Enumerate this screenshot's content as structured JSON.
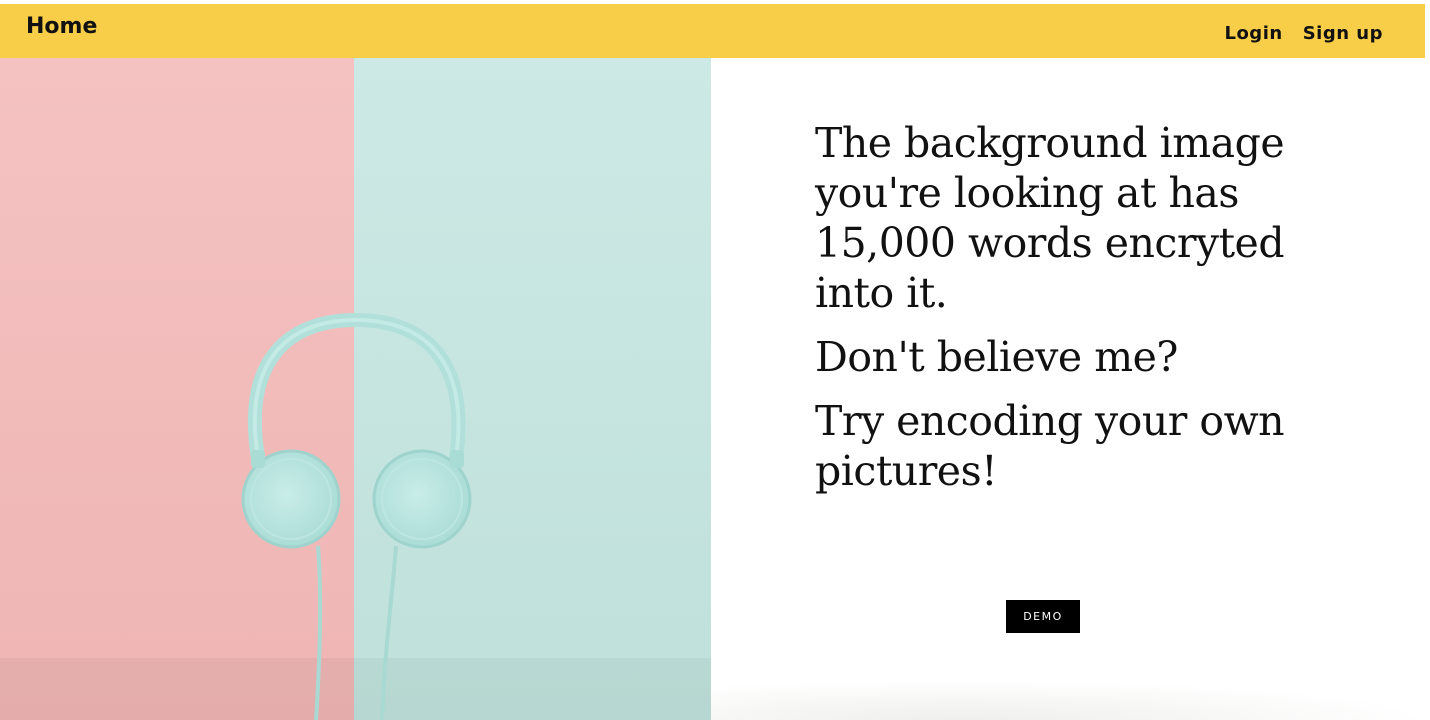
{
  "navbar": {
    "home_label": "Home",
    "login_label": "Login",
    "signup_label": "Sign up"
  },
  "hero": {
    "headlines": [
      "The background image you're looking at has 15,000 words encryted into it.",
      "Don't believe me?",
      "Try encoding your own pictures!"
    ],
    "demo_label": "DEMO"
  },
  "colors": {
    "navbar_bg": "#f8cd48",
    "pink_panel": "#f4bdbd",
    "mint_panel": "#c6e5e0",
    "headphone": "#b6e4df",
    "button_bg": "#000000"
  },
  "icons": {
    "hero_image": "headphones-photo"
  }
}
